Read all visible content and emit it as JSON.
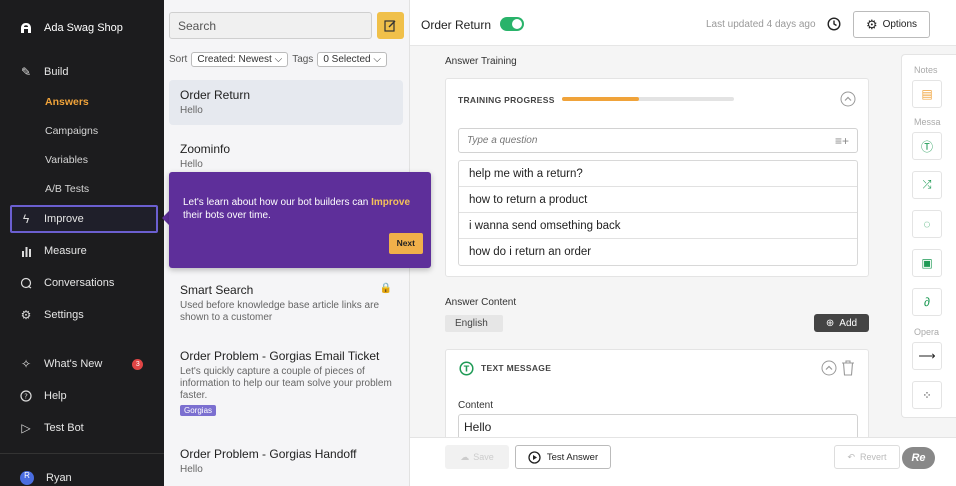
{
  "sidebar": {
    "brand": "Ada Swag Shop",
    "build": "Build",
    "sub": [
      "Answers",
      "Campaigns",
      "Variables",
      "A/B Tests"
    ],
    "improve": "Improve",
    "measure": "Measure",
    "conversations": "Conversations",
    "settings": "Settings",
    "whats_new": "What's New",
    "whats_new_count": "3",
    "help": "Help",
    "test_bot": "Test Bot",
    "user": "Ryan"
  },
  "list": {
    "search_placeholder": "Search",
    "sort_label": "Sort",
    "sort_value": "Created: Newest",
    "tags_label": "Tags",
    "tags_value": "0 Selected",
    "items": [
      {
        "title": "Order Return",
        "sub": "Hello"
      },
      {
        "title": "Zoominfo",
        "sub": "Hello"
      },
      {
        "title": "Smart Search",
        "sub": "Used before knowledge base article links are shown to a customer"
      },
      {
        "title": "Order Problem - Gorgias Email Ticket",
        "sub": "Let's quickly capture a couple of pieces of information to help our team solve your problem faster.",
        "tag": "Gorgias"
      },
      {
        "title": "Order Problem - Gorgias Handoff",
        "sub": "Hello"
      }
    ]
  },
  "tooltip": {
    "text_before": "Let's learn about how our bot builders can ",
    "highlight": "Improve",
    "text_after": " their bots over time.",
    "next": "Next"
  },
  "header": {
    "title": "Order Return",
    "last_updated": "Last updated 4 days ago",
    "options": "Options"
  },
  "training": {
    "section": "Answer Training",
    "progress_label": "TRAINING PROGRESS",
    "progress": 0.45,
    "question_placeholder": "Type a question",
    "questions": [
      "help me with a return?",
      "how to return a product",
      "i wanna send omsething back",
      "how do i return an order"
    ]
  },
  "content": {
    "section": "Answer Content",
    "language": "English",
    "add": "Add",
    "block_label": "TEXT MESSAGE",
    "content_label": "Content",
    "content_value": "Hello"
  },
  "footer": {
    "save": "Save",
    "test": "Test Answer",
    "revert": "Revert",
    "logo": "Re"
  },
  "toolbox": {
    "notes": "Notes",
    "messages": "Messa",
    "operations": "Opera"
  },
  "colors": {
    "accent": "#f0a33a",
    "tooltip": "#5e2f9a",
    "toggle_on": "#29b36a",
    "sidebar": "#1c1c1e"
  }
}
